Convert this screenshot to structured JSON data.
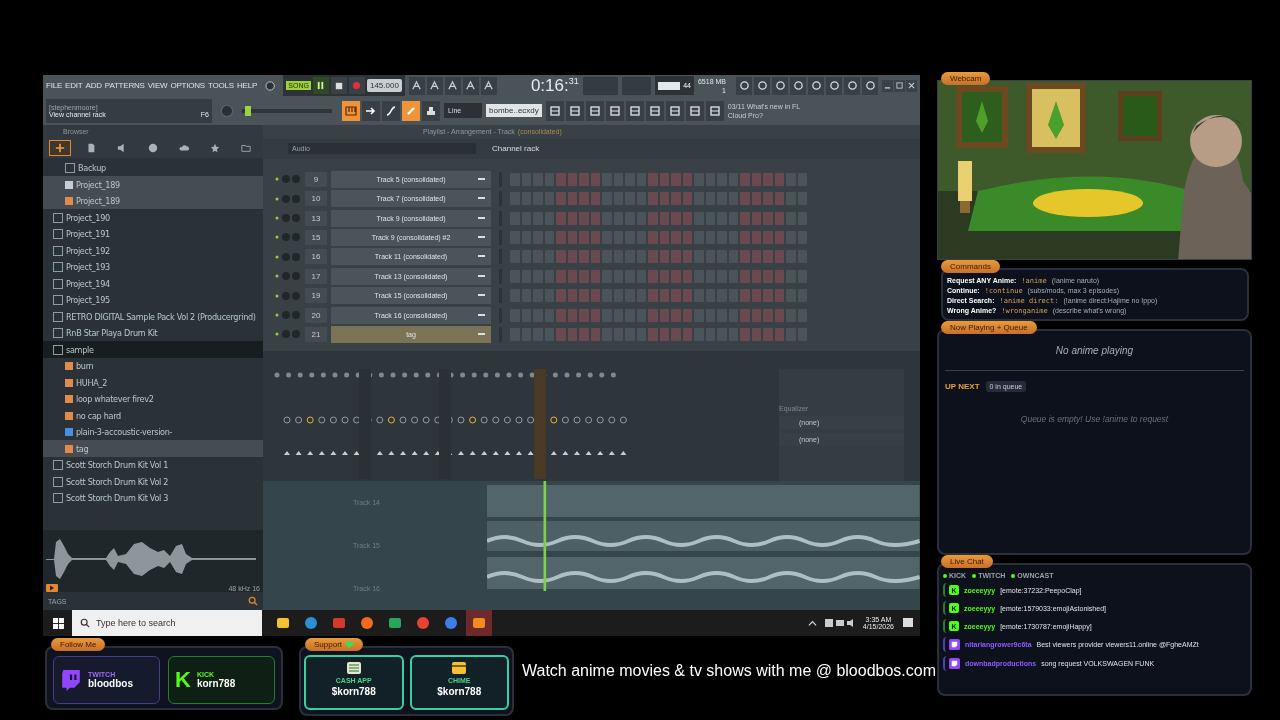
{
  "fl": {
    "menu": [
      "FILE",
      "EDIT",
      "ADD",
      "PATTERNS",
      "VIEW",
      "OPTIONS",
      "TOOLS",
      "HELP"
    ],
    "hint": {
      "user": "[stephenmoore]",
      "text": "View channel rack",
      "key": "F6"
    },
    "transport": {
      "mode": "SONG",
      "playing": true,
      "tempo": "145.000",
      "time": "0:16:$^{31}$"
    },
    "meters": {
      "cpu": "44",
      "memory": "6518 MB",
      "voices": "1"
    },
    "tool_buttons": [
      {
        "kind": "piano",
        "on": true
      },
      {
        "kind": "arrow",
        "on": false
      },
      {
        "kind": "slide",
        "on": false
      },
      {
        "kind": "link",
        "on": true
      },
      {
        "kind": "stamp",
        "on": false
      }
    ],
    "pitch_slider": {
      "level": 0.04
    },
    "snap": "Line",
    "pattern": "bombe..ecxdy",
    "news": "03/11 What's new in FL Cloud Pro?",
    "browser": {
      "title": "Browser",
      "tabs": [
        {
          "kind": "plus",
          "selected": true
        },
        {
          "kind": "file",
          "selected": false
        },
        {
          "kind": "speaker",
          "selected": false
        },
        {
          "kind": "globe",
          "selected": false
        },
        {
          "kind": "cloud",
          "selected": false
        },
        {
          "kind": "star",
          "selected": false
        },
        {
          "kind": "folder",
          "selected": false
        }
      ],
      "scrolled_branch": [
        {
          "label": "Backup",
          "kind": "folder",
          "selected": false
        },
        {
          "label": "Project_189",
          "kind": "file",
          "selected": true
        },
        {
          "label": "Project_189",
          "kind": "audio",
          "selected": true
        }
      ],
      "items": [
        {
          "label": "Project_190",
          "kind": "folder",
          "selected": false,
          "expanded": false
        },
        {
          "label": "Project_191",
          "kind": "folder",
          "selected": false,
          "expanded": false
        },
        {
          "label": "Project_192",
          "kind": "folder",
          "selected": false,
          "expanded": false
        },
        {
          "label": "Project_193",
          "kind": "folder",
          "selected": false,
          "expanded": false
        },
        {
          "label": "Project_194",
          "kind": "folder",
          "selected": false,
          "expanded": false
        },
        {
          "label": "Project_195",
          "kind": "folder",
          "selected": false,
          "expanded": false
        },
        {
          "label": "RETRO DIGITAL Sample Pack Vol 2 (Producergrind)",
          "kind": "folder",
          "selected": false,
          "expanded": false
        },
        {
          "label": "RnB Star Playa Drum Kit",
          "kind": "folder",
          "selected": false,
          "expanded": false
        },
        {
          "label": "sample",
          "kind": "folder",
          "selected": false,
          "expanded": true,
          "children": [
            {
              "label": "burn",
              "kind": "audio",
              "selected": false
            },
            {
              "label": "HUHA_2",
              "kind": "audio",
              "selected": false
            },
            {
              "label": "loop whatever firev2",
              "kind": "audio",
              "selected": false
            },
            {
              "label": "no cap hard",
              "kind": "audio",
              "selected": false
            },
            {
              "label": "plain-3-accoustic-version-",
              "kind": "project",
              "selected": false
            },
            {
              "label": "tag",
              "kind": "audio",
              "selected": true
            }
          ]
        },
        {
          "label": "Scott Storch Drum Kit Vol 1",
          "kind": "folder",
          "selected": false,
          "expanded": false
        },
        {
          "label": "Scott Storch Drum Kit Vol 2",
          "kind": "folder",
          "selected": false,
          "expanded": false
        },
        {
          "label": "Scott Storch Drum Kit Vol 3",
          "kind": "folder",
          "selected": false,
          "expanded": false
        }
      ],
      "sample_info": "48 kHz 16",
      "tags_label": "TAGS"
    },
    "playlist": {
      "title": "Playlist - Arrangement - Track",
      "subtitle": "(consolidated)",
      "tracks": [
        "Track 14",
        "Track 15",
        "Track 16"
      ]
    },
    "channel_rack": {
      "filter": "Audio",
      "title": "Channel rack",
      "channels": [
        {
          "number": "9",
          "name": "Track 5 (consolidated)",
          "selected": false
        },
        {
          "number": "10",
          "name": "Track 7 (consolidated)",
          "selected": false
        },
        {
          "number": "13",
          "name": "Track 9 (consolidated)",
          "selected": false
        },
        {
          "number": "15",
          "name": "Track 9 (consolidated) #2",
          "selected": false
        },
        {
          "number": "16",
          "name": "Track 11 (consolidated)",
          "selected": false
        },
        {
          "number": "17",
          "name": "Track 13 (consolidated)",
          "selected": false
        },
        {
          "number": "19",
          "name": "Track 15 (consolidated)",
          "selected": false
        },
        {
          "number": "20",
          "name": "Track 16 (consolidated)",
          "selected": false
        },
        {
          "number": "21",
          "name": "tag",
          "selected": true
        }
      ]
    },
    "mixer": {
      "plugin_title": "Equalizer",
      "slots": [
        "(none)",
        "(none)"
      ]
    }
  },
  "taskbar": {
    "search_placeholder": "Type here to search",
    "apps": [
      {
        "kind": "files",
        "selected": false
      },
      {
        "kind": "edge",
        "selected": false
      },
      {
        "kind": "red",
        "selected": false
      },
      {
        "kind": "firefox",
        "selected": false
      },
      {
        "kind": "green",
        "selected": false
      },
      {
        "kind": "chrome",
        "selected": false
      },
      {
        "kind": "blue",
        "selected": false
      },
      {
        "kind": "fl",
        "selected": true
      }
    ],
    "time": "3:35 AM",
    "date": "4/15/2026"
  },
  "follow": {
    "title": "Follow Me",
    "cards": [
      {
        "kind": "twitch",
        "label": "TWITCH",
        "handle": "bloodbos"
      },
      {
        "kind": "kick",
        "logo": "K",
        "label": "KICK",
        "handle": "korn788"
      }
    ]
  },
  "support": {
    "title": "Support",
    "cards": [
      {
        "kind": "cashapp",
        "label": "CASH APP",
        "handle": "$korn788"
      },
      {
        "kind": "chime",
        "label": "CHIME",
        "handle": "$korn788"
      }
    ]
  },
  "ticker": "Watch anime movies & tv shows with me @ bloodbos.com",
  "webcam": {
    "label": "Webcam"
  },
  "commands": {
    "title": "Commands",
    "rows": [
      {
        "label": "Request ANY Anime:",
        "command": "!anime",
        "example": "(!anime naruto)"
      },
      {
        "label": "Continue:",
        "command": "!continue",
        "example": "(subs/mods, max 3 episodes)"
      },
      {
        "label": "Direct Search:",
        "command": "!anime direct:",
        "example": "(!anime direct:Hajime no Ippo)"
      },
      {
        "label": "Wrong Anime?",
        "command": "!wronganime",
        "example": "(describe what's wrong)"
      }
    ]
  },
  "now_playing": {
    "title": "Now Playing + Queue",
    "status": "No anime playing",
    "up_next": "UP NEXT",
    "queue_count": "0 in queue",
    "empty": "Queue is empty! Use !anime to request"
  },
  "chat": {
    "title": "Live Chat",
    "platforms": [
      {
        "label": "KICK",
        "connected": true
      },
      {
        "label": "TWITCH",
        "connected": true
      },
      {
        "label": "OWNCAST",
        "connected": true
      }
    ],
    "messages": [
      {
        "kind": "kick",
        "badge": "K",
        "user": "zoeeeyyy",
        "text": "[emote:37232:PeepoClap]"
      },
      {
        "kind": "kick",
        "badge": "K",
        "user": "zoeeeyyy",
        "text": "[emote:1579033:emojiAstonished]"
      },
      {
        "kind": "kick",
        "badge": "K",
        "user": "zoeeeyyy",
        "text": "[emote:1730787:emojiHappy]"
      },
      {
        "kind": "twitch",
        "user": "nitariangrower9c6ta",
        "text": "Best viewers provider viewers11.online @FgheAMZt"
      },
      {
        "kind": "twitch",
        "user": "downbadproductions",
        "text": "song request VOLKSWAGEN FUNK"
      }
    ]
  }
}
